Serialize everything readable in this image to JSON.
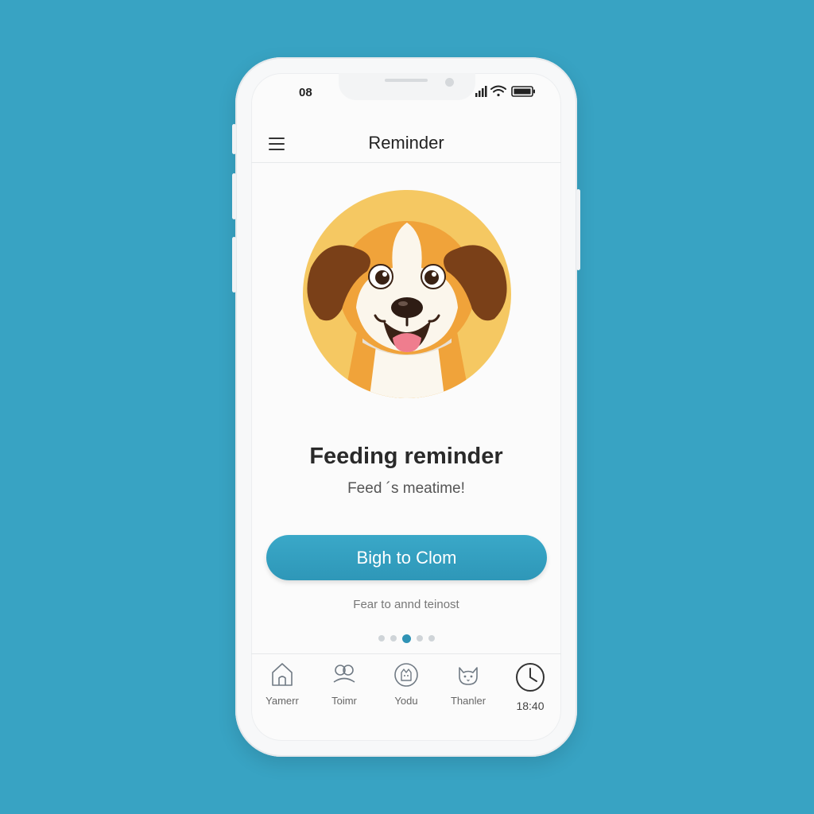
{
  "status": {
    "time": "08"
  },
  "header": {
    "title": "Reminder"
  },
  "hero": {
    "image": "dog-illustration"
  },
  "content": {
    "headline": "Feeding reminder",
    "subline": "Feed ´s meatime!",
    "cta_label": "Bigh to Clom",
    "secondary": "Fear to annd teinost"
  },
  "pager": {
    "count": 5,
    "active_index": 2
  },
  "tabs": [
    {
      "label": "Yamerr",
      "icon": "house-icon"
    },
    {
      "label": "Toimr",
      "icon": "people-icon"
    },
    {
      "label": "Yodu",
      "icon": "pet-icon"
    },
    {
      "label": "Thanler",
      "icon": "cat-icon"
    },
    {
      "label": "18:40",
      "icon": "clock-icon"
    }
  ],
  "colors": {
    "background": "#38a3c3",
    "accent": "#2e97b8",
    "hero_circle": "#f5c862",
    "dog_orange": "#efa035",
    "dog_brown": "#7a4018"
  }
}
